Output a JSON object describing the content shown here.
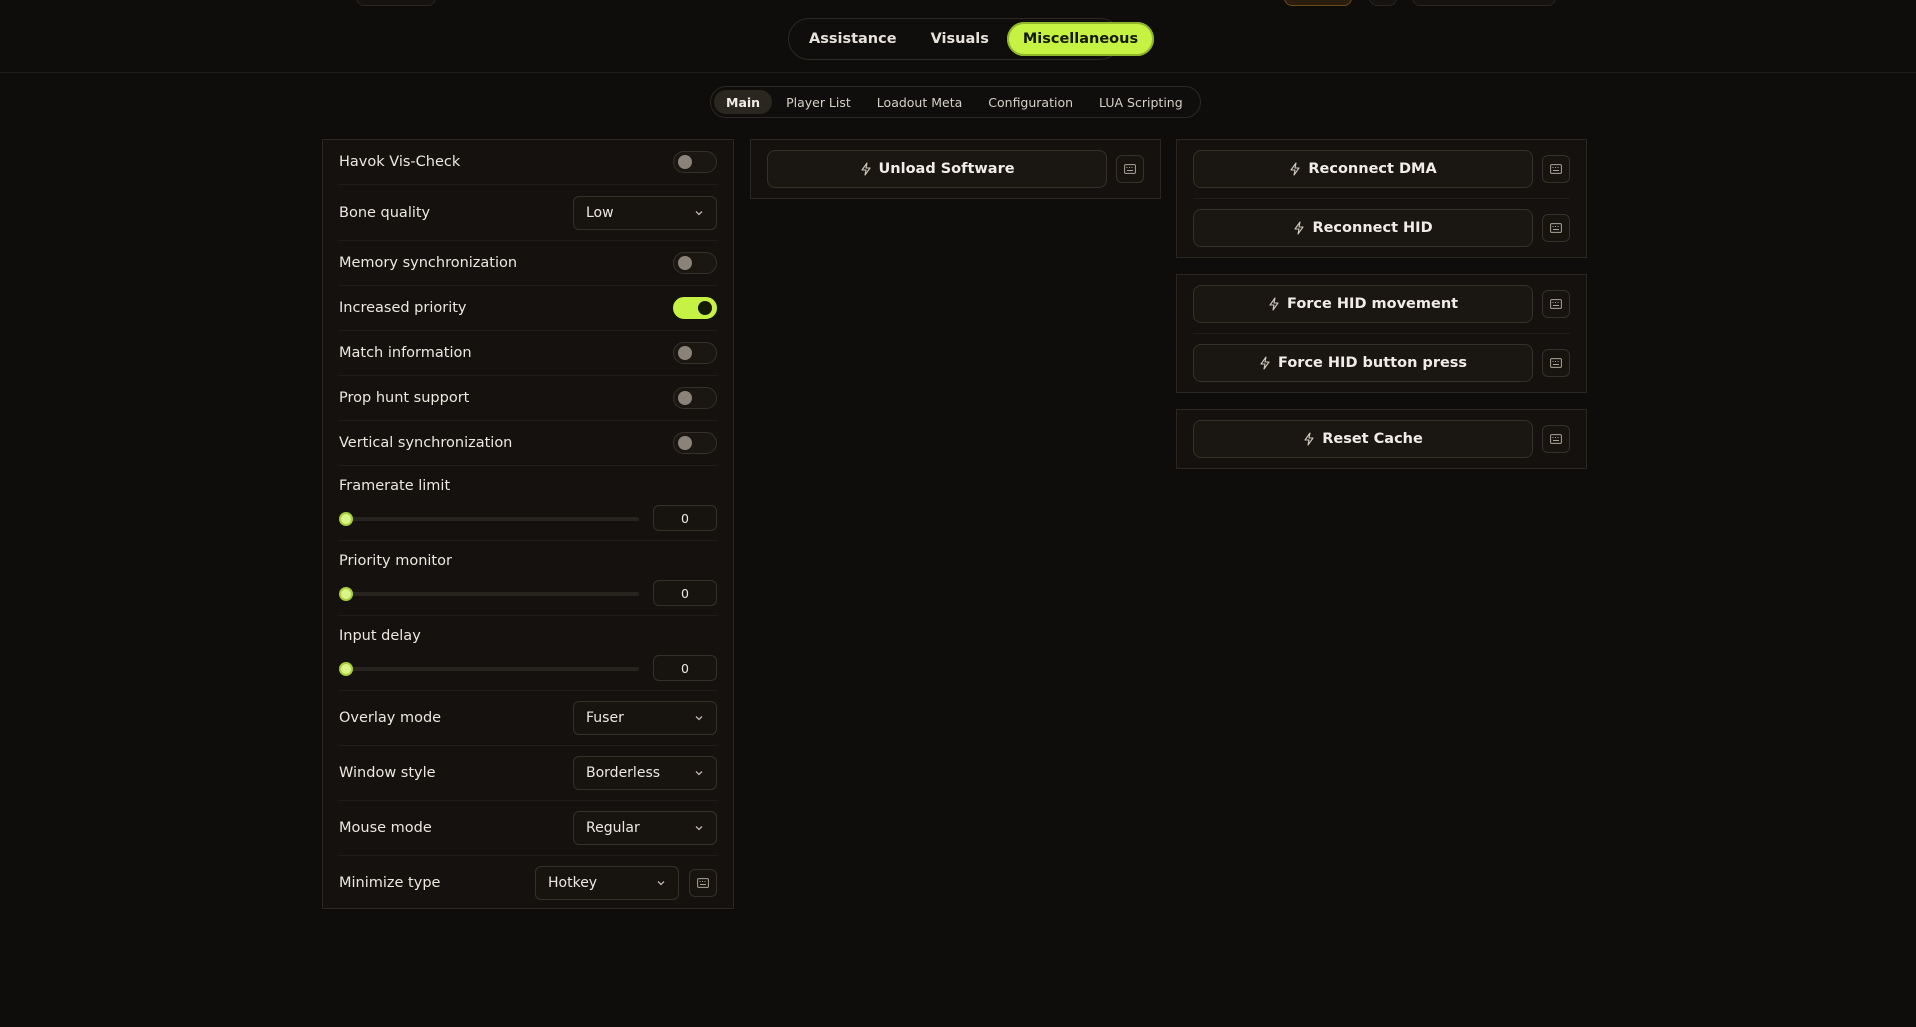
{
  "main_tabs": [
    "Assistance",
    "Visuals",
    "Miscellaneous"
  ],
  "main_tab_active": "Miscellaneous",
  "sub_tabs": [
    "Main",
    "Player List",
    "Loadout Meta",
    "Configuration",
    "LUA Scripting"
  ],
  "sub_tab_active": "Main",
  "left_panel": {
    "havok": {
      "label": "Havok Vis-Check",
      "on": false
    },
    "bone_quality": {
      "label": "Bone quality",
      "value": "Low"
    },
    "memory_sync": {
      "label": "Memory synchronization",
      "on": false
    },
    "increased_priority": {
      "label": "Increased priority",
      "on": true
    },
    "match_info": {
      "label": "Match information",
      "on": false
    },
    "prop_hunt": {
      "label": "Prop hunt support",
      "on": false
    },
    "vsync": {
      "label": "Vertical synchronization",
      "on": false
    },
    "framerate_limit": {
      "label": "Framerate limit",
      "value": "0"
    },
    "priority_monitor": {
      "label": "Priority monitor",
      "value": "0"
    },
    "input_delay": {
      "label": "Input delay",
      "value": "0"
    },
    "overlay_mode": {
      "label": "Overlay mode",
      "value": "Fuser"
    },
    "window_style": {
      "label": "Window style",
      "value": "Borderless"
    },
    "mouse_mode": {
      "label": "Mouse mode",
      "value": "Regular"
    },
    "minimize_type": {
      "label": "Minimize type",
      "value": "Hotkey"
    }
  },
  "middle_panel": {
    "unload": "Unload Software"
  },
  "right_panels": {
    "reconnect_dma": "Reconnect DMA",
    "reconnect_hid": "Reconnect HID",
    "force_hid_movement": "Force HID movement",
    "force_hid_button": "Force HID button press",
    "reset_cache": "Reset Cache"
  },
  "colors": {
    "accent": "#c6f244",
    "background": "#0f0d0b",
    "panel": "#14110e"
  }
}
